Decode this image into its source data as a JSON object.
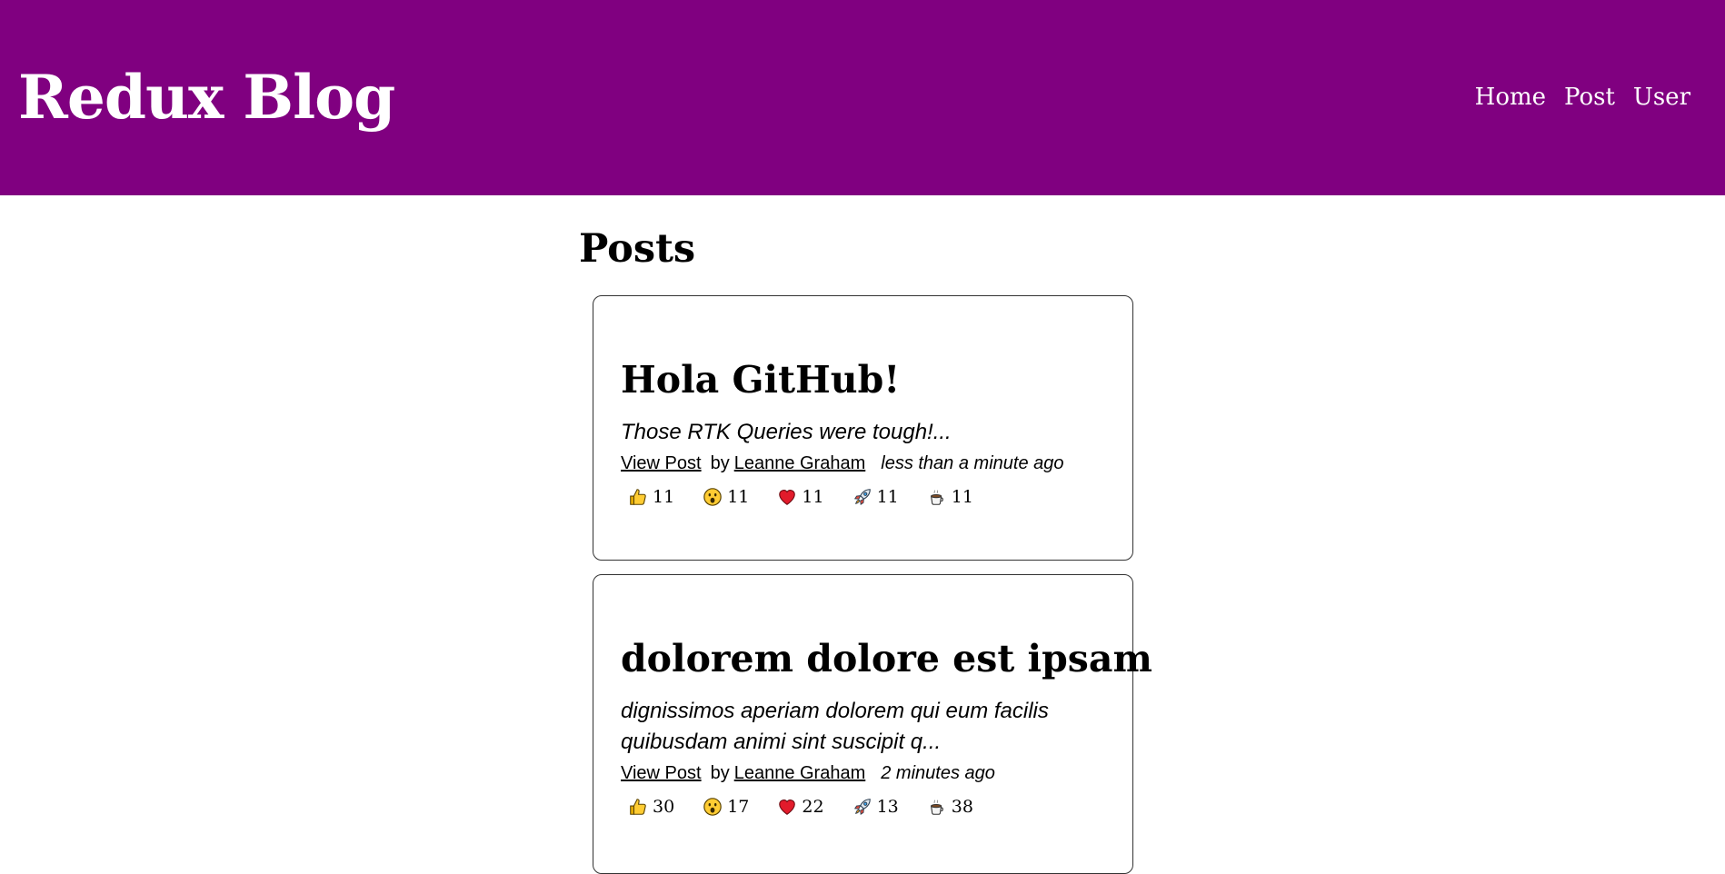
{
  "header": {
    "title": "Redux Blog",
    "nav": [
      {
        "label": "Home"
      },
      {
        "label": "Post"
      },
      {
        "label": "User"
      }
    ],
    "background_color": "#800080"
  },
  "main": {
    "heading": "Posts",
    "posts": [
      {
        "title": "Hola GitHub!",
        "excerpt_lines": [
          "Those RTK Queries were tough!..."
        ],
        "view_label": "View Post",
        "by_label": "by",
        "author": "Leanne Graham",
        "time": "less than a minute ago",
        "reactions": [
          {
            "icon": "thumbs-up-icon",
            "count": "11"
          },
          {
            "icon": "wow-face-icon",
            "count": "11"
          },
          {
            "icon": "heart-icon",
            "count": "11"
          },
          {
            "icon": "rocket-icon",
            "count": "11"
          },
          {
            "icon": "coffee-icon",
            "count": "11"
          }
        ]
      },
      {
        "title": "dolorem dolore est ipsam",
        "excerpt_lines": [
          "dignissimos aperiam dolorem qui eum facilis",
          "quibusdam animi sint suscipit q..."
        ],
        "view_label": "View Post",
        "by_label": "by",
        "author": "Leanne Graham",
        "time": "2 minutes ago",
        "reactions": [
          {
            "icon": "thumbs-up-icon",
            "count": "30"
          },
          {
            "icon": "wow-face-icon",
            "count": "17"
          },
          {
            "icon": "heart-icon",
            "count": "22"
          },
          {
            "icon": "rocket-icon",
            "count": "13"
          },
          {
            "icon": "coffee-icon",
            "count": "38"
          }
        ]
      }
    ]
  }
}
